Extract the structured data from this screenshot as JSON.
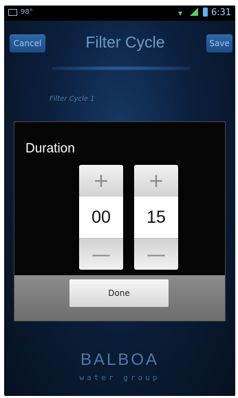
{
  "status_bar": {
    "temperature": "98°",
    "time": "6:31",
    "icons": [
      "picture-icon",
      "wifi-icon",
      "signal-icon",
      "battery-icon"
    ]
  },
  "header": {
    "cancel_label": "Cancel",
    "title": "Filter Cycle",
    "save_label": "Save"
  },
  "background": {
    "section_label": "Filter Cycle 1"
  },
  "dialog": {
    "title": "Duration",
    "hours": {
      "increment_label": "+",
      "value": "00",
      "decrement_label": "—"
    },
    "minutes": {
      "increment_label": "+",
      "value": "15",
      "decrement_label": "—"
    },
    "done_label": "Done"
  },
  "logo": {
    "brand": "BALBOA",
    "tagline": "water group"
  },
  "colors": {
    "background_dark": "#0b1f3d",
    "accent_blue": "#2d67a8",
    "status_green": "#4fd06a",
    "dialog_bg": "#050505"
  }
}
